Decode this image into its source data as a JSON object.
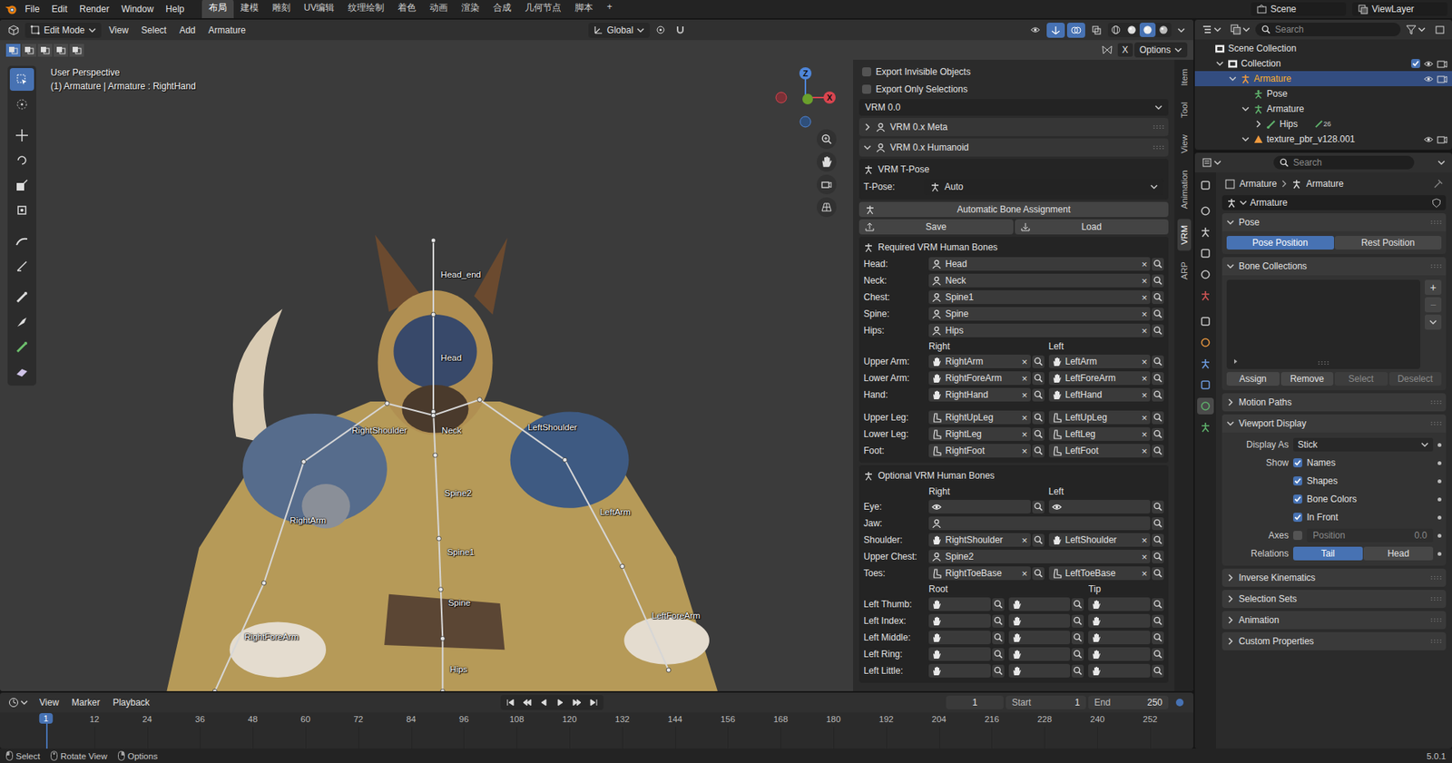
{
  "topbar": {
    "menus": [
      "File",
      "Edit",
      "Render",
      "Window",
      "Help"
    ],
    "workspaces": [
      {
        "label": "布局",
        "selected": true
      },
      {
        "label": "建模",
        "selected": false
      },
      {
        "label": "雕刻",
        "selected": false
      },
      {
        "label": "UV编辑",
        "selected": false
      },
      {
        "label": "纹理绘制",
        "selected": false
      },
      {
        "label": "着色",
        "selected": false
      },
      {
        "label": "动画",
        "selected": false
      },
      {
        "label": "渲染",
        "selected": false
      },
      {
        "label": "合成",
        "selected": false
      },
      {
        "label": "几何节点",
        "selected": false
      },
      {
        "label": "脚本",
        "selected": false
      }
    ],
    "add_workspace": "+",
    "scene": "Scene",
    "view_layer": "ViewLayer"
  },
  "viewport": {
    "mode": "Edit Mode",
    "menus": [
      "View",
      "Select",
      "Add",
      "Armature"
    ],
    "orientation": "Global",
    "options": "Options",
    "select_modes": [
      {
        "selected": true
      },
      {
        "selected": false
      },
      {
        "selected": false
      },
      {
        "selected": false
      },
      {
        "selected": false
      }
    ],
    "shading": [
      {
        "selected": false
      },
      {
        "selected": false
      },
      {
        "selected": true
      },
      {
        "selected": false
      }
    ],
    "view_name": "User Perspective",
    "object_info": "(1) Armature | Armature : RightHand",
    "tools": [
      {
        "selected": true
      },
      {
        "selected": false
      },
      {
        "selected": false
      },
      {
        "selected": false
      },
      {
        "selected": false
      },
      {
        "selected": false
      },
      {
        "selected": false
      },
      {
        "selected": false
      },
      {
        "selected": false
      },
      {
        "selected": false
      },
      {
        "selected": false
      },
      {
        "selected": false
      }
    ],
    "bone_labels": [
      "Head_end",
      "Head",
      "Neck",
      "RightShoulder",
      "LeftShoulder",
      "Spine2",
      "RightArm",
      "LeftArm",
      "Spine1",
      "Spine",
      "LeftForeArm",
      "RightForeArm",
      "Hips"
    ],
    "gizmo": {
      "z": "Z",
      "x": "X"
    }
  },
  "sidebar": {
    "tabs": [
      {
        "label": "Item",
        "selected": false
      },
      {
        "label": "Tool",
        "selected": false
      },
      {
        "label": "View",
        "selected": false
      },
      {
        "label": "Animation",
        "selected": false
      },
      {
        "label": "VRM",
        "selected": true
      },
      {
        "label": "ARP",
        "selected": false
      }
    ],
    "export_options": [
      {
        "label": "Export Invisible Objects",
        "checked": false
      },
      {
        "label": "Export Only Selections",
        "checked": false
      }
    ],
    "version": "VRM 0.0",
    "panels": [
      {
        "title": "VRM 0.x Meta",
        "expanded": false
      },
      {
        "title": "VRM 0.x Humanoid",
        "expanded": true
      }
    ],
    "tpose": {
      "title": "VRM T-Pose",
      "label": "T-Pose:",
      "value": "Auto"
    },
    "auto_assign": "Automatic Bone Assignment",
    "save": "Save",
    "load": "Load",
    "clear": "×",
    "required": {
      "title": "Required VRM Human Bones",
      "side_headers": [
        "Right",
        "Left"
      ],
      "torso": [
        {
          "label": "Head:",
          "value": "Head"
        },
        {
          "label": "Neck:",
          "value": "Neck"
        },
        {
          "label": "Chest:",
          "value": "Spine1"
        },
        {
          "label": "Spine:",
          "value": "Spine"
        },
        {
          "label": "Hips:",
          "value": "Hips"
        }
      ],
      "arms": [
        {
          "label": "Upper Arm:",
          "right": "RightArm",
          "left": "LeftArm"
        },
        {
          "label": "Lower Arm:",
          "right": "RightForeArm",
          "left": "LeftForeArm"
        },
        {
          "label": "Hand:",
          "right": "RightHand",
          "left": "LeftHand"
        }
      ],
      "legs": [
        {
          "label": "Upper Leg:",
          "right": "RightUpLeg",
          "left": "LeftUpLeg"
        },
        {
          "label": "Lower Leg:",
          "right": "RightLeg",
          "left": "LeftLeg"
        },
        {
          "label": "Foot:",
          "right": "RightFoot",
          "left": "LeftFoot"
        }
      ]
    },
    "optional": {
      "title": "Optional VRM Human Bones",
      "side_headers": [
        "Right",
        "Left"
      ],
      "rows": [
        {
          "label": "Eye:",
          "kind": "pair",
          "part": "eye",
          "right": "",
          "left": ""
        },
        {
          "label": "Jaw:",
          "kind": "single",
          "part": "torso",
          "value": ""
        },
        {
          "label": "Shoulder:",
          "kind": "pair",
          "part": "arm",
          "right": "RightShoulder",
          "left": "LeftShoulder"
        },
        {
          "label": "Upper Chest:",
          "kind": "single",
          "part": "torso",
          "value": "Spine2"
        },
        {
          "label": "Toes:",
          "kind": "pair",
          "part": "leg",
          "right": "RightToeBase",
          "left": "LeftToeBase"
        }
      ],
      "finger_headers": [
        "Root",
        "Tip"
      ],
      "fingers": [
        "Left Thumb:",
        "Left Index:",
        "Left Middle:",
        "Left Ring:",
        "Left Little:"
      ]
    }
  },
  "timeline": {
    "menus": [
      "View",
      "Marker",
      "Playback"
    ],
    "current_frame": "1",
    "start_label": "Start",
    "start": "1",
    "end_label": "End",
    "end": "250",
    "marker": "1",
    "ticks": [
      "12",
      "24",
      "36",
      "48",
      "60",
      "72",
      "84",
      "96",
      "108",
      "120",
      "132",
      "144",
      "156",
      "168",
      "180",
      "192",
      "204",
      "216",
      "228",
      "240",
      "252"
    ]
  },
  "outliner": {
    "search": "Search",
    "rows": [
      {
        "label": "Scene Collection",
        "kind": "scene",
        "depth": 0,
        "expandable": false,
        "expanded": false,
        "selected": false,
        "restrict": false,
        "included": false
      },
      {
        "label": "Collection",
        "kind": "collection",
        "depth": 1,
        "expandable": true,
        "expanded": true,
        "selected": false,
        "restrict": true,
        "included": true
      },
      {
        "label": "Armature",
        "kind": "armature",
        "depth": 2,
        "expandable": true,
        "expanded": true,
        "selected": true,
        "restrict": true,
        "included": false
      },
      {
        "label": "Pose",
        "kind": "pose",
        "depth": 3,
        "expandable": false,
        "expanded": false,
        "selected": false,
        "restrict": false,
        "included": false
      },
      {
        "label": "Armature",
        "kind": "data",
        "depth": 3,
        "expandable": true,
        "expanded": true,
        "selected": false,
        "restrict": false,
        "included": false
      },
      {
        "label": "Hips",
        "kind": "bone",
        "depth": 4,
        "expandable": true,
        "expanded": false,
        "selected": false,
        "restrict": false,
        "included": false,
        "badge": "26"
      },
      {
        "label": "texture_pbr_v128.001",
        "kind": "mesh",
        "depth": 3,
        "expandable": true,
        "expanded": true,
        "selected": false,
        "restrict": true,
        "included": false
      }
    ]
  },
  "properties": {
    "search": "Search",
    "tabs": [
      {
        "color": "#c8c8c8",
        "selected": false
      },
      {
        "color": "#c8c8c8",
        "selected": false
      },
      {
        "color": "#c8c8c8",
        "selected": false
      },
      {
        "color": "#c8c8c8",
        "selected": false
      },
      {
        "color": "#c8c8c8",
        "selected": false
      },
      {
        "color": "#d05555",
        "selected": false
      },
      {
        "color": "#c8c8c8",
        "selected": false
      },
      {
        "color": "#e8973f",
        "selected": false
      },
      {
        "color": "#6d9ce0",
        "selected": false
      },
      {
        "color": "#6d9ce0",
        "selected": false
      },
      {
        "color": "#5fb26c",
        "selected": true
      },
      {
        "color": "#5fb26c",
        "selected": false
      }
    ],
    "breadcrumb": [
      "Armature",
      "Armature"
    ],
    "datablock": "Armature",
    "pose": {
      "title": "Pose",
      "expanded": true,
      "options": [
        {
          "label": "Pose Position",
          "selected": true
        },
        {
          "label": "Rest Position",
          "selected": false
        }
      ]
    },
    "bone_collections": {
      "title": "Bone Collections",
      "expanded": true,
      "add": "+",
      "remove": "−",
      "buttons": [
        {
          "label": "Assign",
          "disabled": false
        },
        {
          "label": "Remove",
          "disabled": false
        },
        {
          "label": "Select",
          "disabled": true
        },
        {
          "label": "Deselect",
          "disabled": true
        }
      ]
    },
    "motion_paths": {
      "title": "Motion Paths",
      "expanded": false
    },
    "viewport_display": {
      "title": "Viewport Display",
      "expanded": true,
      "display_as_label": "Display As",
      "display_as": "Stick",
      "show_label": "Show",
      "show": [
        {
          "label": "Names",
          "checked": true
        },
        {
          "label": "Shapes",
          "checked": true
        },
        {
          "label": "Bone Colors",
          "checked": true
        },
        {
          "label": "In Front",
          "checked": true
        }
      ],
      "axes_label": "Axes",
      "axes_checked": false,
      "position_label": "Position",
      "position": "0.0",
      "position_disabled": true,
      "relations_label": "Relations",
      "relations": [
        {
          "label": "Tail",
          "selected": true
        },
        {
          "label": "Head",
          "selected": false
        }
      ]
    },
    "more_panels": [
      {
        "title": "Inverse Kinematics",
        "expanded": false
      },
      {
        "title": "Selection Sets",
        "expanded": false
      },
      {
        "title": "Animation",
        "expanded": false
      },
      {
        "title": "Custom Properties",
        "expanded": false
      }
    ]
  },
  "status_bar": {
    "items": [
      "Select",
      "Rotate View",
      "Options"
    ],
    "version": "5.0.1"
  }
}
